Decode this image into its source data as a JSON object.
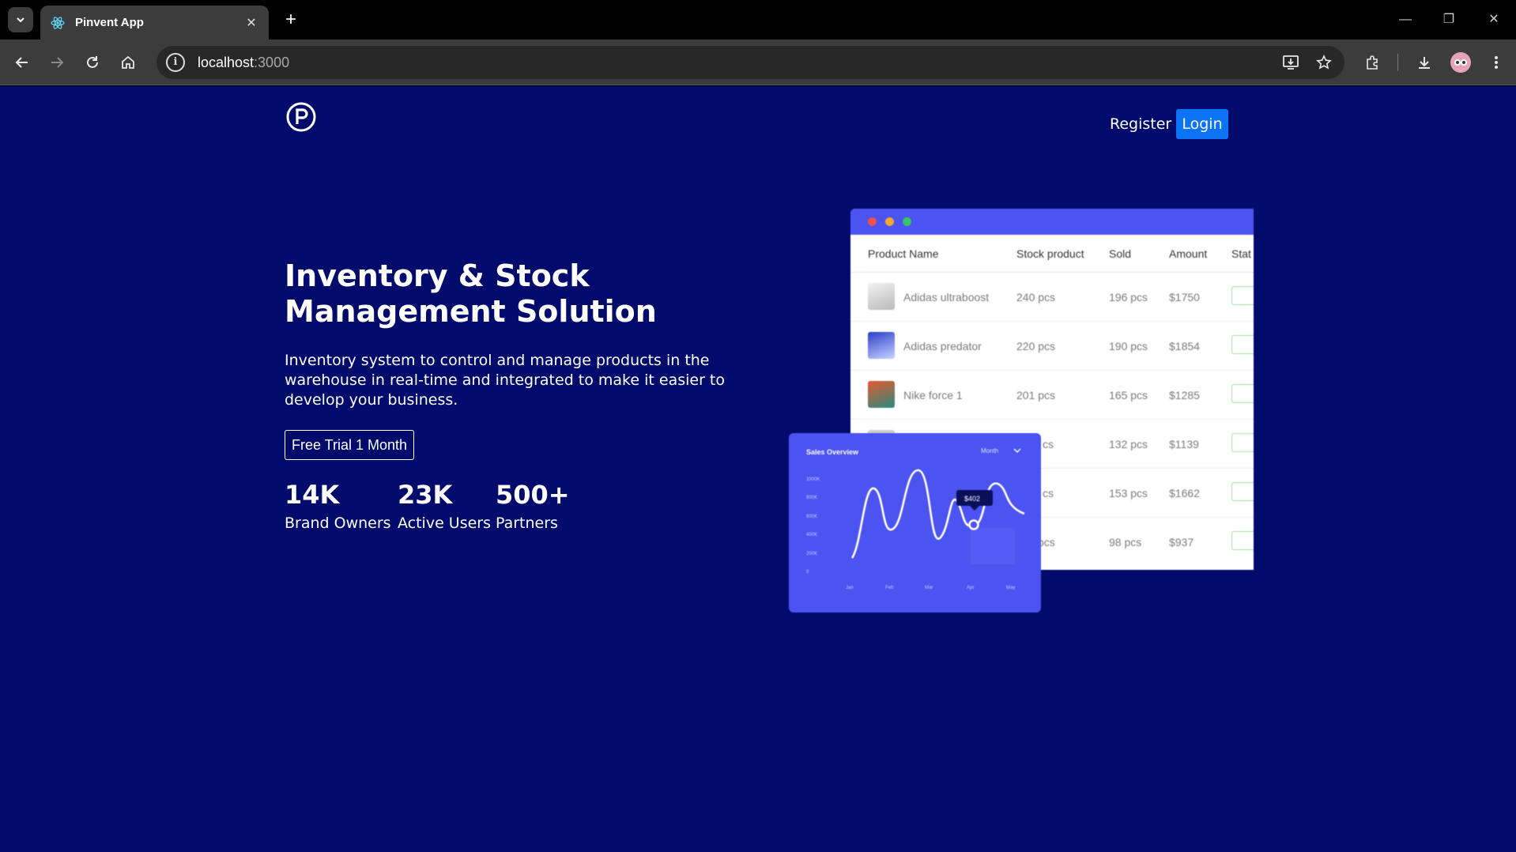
{
  "browser": {
    "tab_title": "Pinvent App",
    "url_host": "localhost",
    "url_port": ":3000"
  },
  "nav": {
    "register": "Register",
    "login": "Login"
  },
  "hero": {
    "title": "Inventory & Stock Management Solution",
    "description": "Inventory system to control and manage products in the warehouse in real-time and integrated to make it easier to develop your business.",
    "cta": "Free Trial 1 Month"
  },
  "stats": [
    {
      "value": "14K",
      "label": "Brand Owners"
    },
    {
      "value": "23K",
      "label": "Active Users"
    },
    {
      "value": "500+",
      "label": "Partners"
    }
  ],
  "mockup_table": {
    "headers": [
      "Product Name",
      "Stock product",
      "Sold",
      "Amount",
      "Stat"
    ],
    "rows": [
      {
        "name": "Adidas ultraboost",
        "stock": "240 pcs",
        "sold": "196 pcs",
        "amount": "$1750"
      },
      {
        "name": "Adidas predator",
        "stock": "220 pcs",
        "sold": "190 pcs",
        "amount": "$1854"
      },
      {
        "name": "Nike force 1",
        "stock": "201 pcs",
        "sold": "165 pcs",
        "amount": "$1285"
      },
      {
        "name": "",
        "stock": "cs",
        "sold": "132 pcs",
        "amount": "$1139"
      },
      {
        "name": "",
        "stock": "cs",
        "sold": "153 pcs",
        "amount": "$1662"
      },
      {
        "name": "",
        "stock": "pcs",
        "sold": "98 pcs",
        "amount": "$937"
      }
    ],
    "window_dots": [
      "#f0504f",
      "#f4a92e",
      "#3cc46a"
    ]
  },
  "mockup_chart": {
    "title": "Sales Overview",
    "period": "Month",
    "y_ticks": [
      "1000K",
      "800K",
      "600K",
      "400K",
      "200K",
      "0"
    ],
    "x_ticks": [
      "Jan",
      "Feb",
      "Mar",
      "Apr",
      "May"
    ],
    "tooltip": "$402"
  },
  "colors": {
    "page_bg": "#010b6c",
    "login_bg": "#0b73f6",
    "mock_accent": "#4b53f0"
  }
}
